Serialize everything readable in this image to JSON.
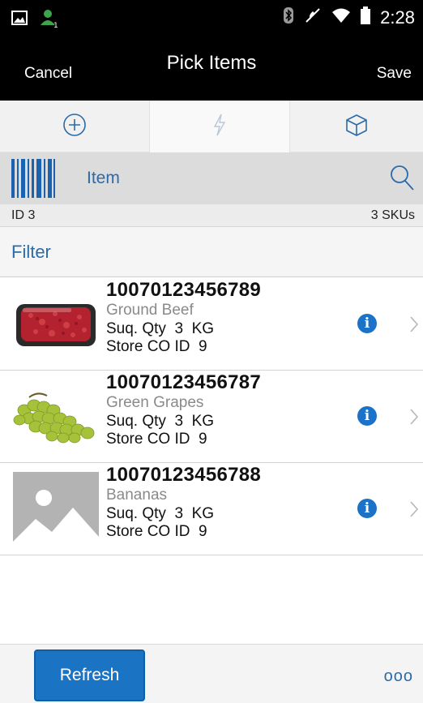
{
  "status_bar": {
    "time": "2:28",
    "left_icons": [
      "image-notification-icon",
      "user-notification-icon"
    ],
    "right_icons": [
      "bluetooth-icon",
      "mute-icon",
      "wifi-icon",
      "battery-icon"
    ]
  },
  "header": {
    "cancel_label": "Cancel",
    "title": "Pick Items",
    "save_label": "Save"
  },
  "tabs": [
    {
      "icon": "plus-circle-icon",
      "active": false
    },
    {
      "icon": "lightning-icon",
      "active": true
    },
    {
      "icon": "box-icon",
      "active": false
    }
  ],
  "scan": {
    "label": "Item",
    "barcode_icon": "barcode-icon",
    "search_icon": "search-icon"
  },
  "info": {
    "id_text": "ID 3",
    "sku_count": "3 SKUs"
  },
  "filter": {
    "label": "Filter"
  },
  "items": [
    {
      "number": "10070123456789",
      "name": "Ground Beef",
      "qty_line": "Suq. Qty  3  KG",
      "store_line": "Store CO ID  9",
      "thumb": "ground-beef-image"
    },
    {
      "number": "10070123456787",
      "name": "Green Grapes",
      "qty_line": "Suq. Qty  3  KG",
      "store_line": "Store CO ID  9",
      "thumb": "green-grapes-image"
    },
    {
      "number": "10070123456788",
      "name": "Bananas",
      "qty_line": "Suq. Qty  3  KG",
      "store_line": "Store CO ID  9",
      "thumb": "placeholder-image"
    }
  ],
  "bottom": {
    "refresh_label": "Refresh",
    "more_label": "ooo"
  },
  "colors": {
    "accent": "#1b73c4",
    "link_blue": "#2c6aa8",
    "header_bg": "#000000"
  }
}
